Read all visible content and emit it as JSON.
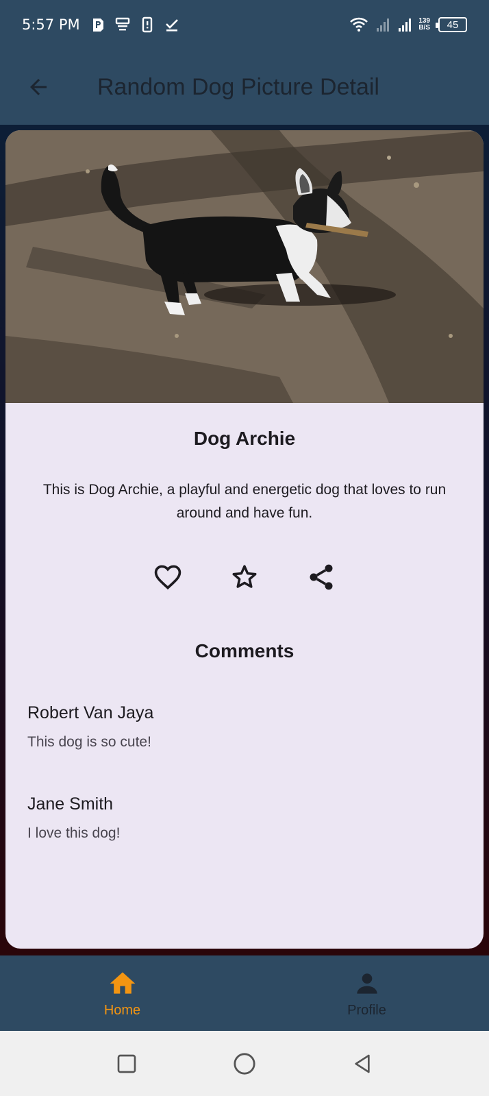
{
  "status_bar": {
    "time": "5:57 PM",
    "network_speed_value": "139",
    "network_speed_unit": "B/S",
    "battery": "45"
  },
  "app_bar": {
    "title": "Random Dog Picture Detail",
    "back_icon": "arrow-back-icon"
  },
  "dog": {
    "name": "Dog Archie",
    "description": "This is Dog Archie, a playful and energetic dog that loves to run around and have fun.",
    "photo_alt": "Black and white corgi carrying a stick"
  },
  "actions": [
    {
      "icon": "heart-icon"
    },
    {
      "icon": "star-icon"
    },
    {
      "icon": "share-icon"
    }
  ],
  "comments": {
    "heading": "Comments",
    "items": [
      {
        "author": "Robert Van Jaya",
        "text": "This dog is so cute!"
      },
      {
        "author": "Jane Smith",
        "text": "I love this dog!"
      }
    ]
  },
  "bottom_nav": {
    "items": [
      {
        "label": "Home",
        "icon": "home-icon",
        "active": true
      },
      {
        "label": "Profile",
        "icon": "person-icon",
        "active": false
      }
    ]
  },
  "colors": {
    "app_bar": "#2e4a62",
    "card": "#ece6f3",
    "active_nav": "#f39512"
  }
}
